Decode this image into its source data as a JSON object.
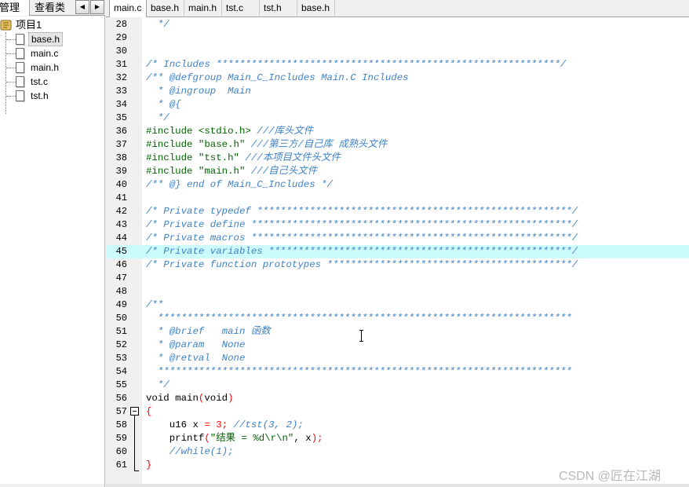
{
  "left_panel": {
    "tabs": [
      "目管理",
      "查看类"
    ],
    "nav": {
      "prev": "◀",
      "next": "▶"
    },
    "tree": {
      "root": "项目1",
      "files": [
        "base.h",
        "main.c",
        "main.h",
        "tst.c",
        "tst.h"
      ],
      "selected": "base.h"
    }
  },
  "editor": {
    "tabs": [
      "main.c",
      "base.h",
      "main.h",
      "tst.c",
      "tst.h",
      "base.h"
    ],
    "active_tab": "main.c",
    "highlighted_line": 45,
    "lines": [
      {
        "n": "28",
        "t": [
          [
            "c",
            "  */"
          ]
        ]
      },
      {
        "n": "29",
        "t": []
      },
      {
        "n": "30",
        "t": []
      },
      {
        "n": "31",
        "t": [
          [
            "c",
            "/* Includes ***********************************************************/"
          ]
        ]
      },
      {
        "n": "32",
        "t": [
          [
            "c",
            "/** @defgroup Main_C_Includes Main.C Includes"
          ]
        ]
      },
      {
        "n": "33",
        "t": [
          [
            "c",
            "  * @ingroup  Main"
          ]
        ]
      },
      {
        "n": "34",
        "t": [
          [
            "c",
            "  * @{"
          ]
        ]
      },
      {
        "n": "35",
        "t": [
          [
            "c",
            "  */"
          ]
        ]
      },
      {
        "n": "36",
        "t": [
          [
            "d",
            "#include "
          ],
          [
            "s",
            "<stdio.h>"
          ],
          [
            "c",
            " ///库头文件"
          ]
        ]
      },
      {
        "n": "37",
        "t": [
          [
            "d",
            "#include "
          ],
          [
            "s",
            "\"base.h\""
          ],
          [
            "c",
            " ///第三方/自己库 成熟头文件"
          ]
        ]
      },
      {
        "n": "38",
        "t": [
          [
            "d",
            "#include "
          ],
          [
            "s",
            "\"tst.h\""
          ],
          [
            "c",
            " ///本项目文件头文件"
          ]
        ]
      },
      {
        "n": "39",
        "t": [
          [
            "d",
            "#include "
          ],
          [
            "s",
            "\"main.h\""
          ],
          [
            "c",
            " ///自己头文件"
          ]
        ]
      },
      {
        "n": "40",
        "t": [
          [
            "c",
            "/** @} end of Main_C_Includes */"
          ]
        ]
      },
      {
        "n": "41",
        "t": []
      },
      {
        "n": "42",
        "t": [
          [
            "c",
            "/* Private typedef ******************************************************/"
          ]
        ]
      },
      {
        "n": "43",
        "t": [
          [
            "c",
            "/* Private define *******************************************************/"
          ]
        ]
      },
      {
        "n": "44",
        "t": [
          [
            "c",
            "/* Private macros *******************************************************/"
          ]
        ]
      },
      {
        "n": "45",
        "t": [
          [
            "c",
            "/* Private variables ****************************************************/"
          ]
        ]
      },
      {
        "n": "46",
        "t": [
          [
            "c",
            "/* Private function prototypes ******************************************/"
          ]
        ]
      },
      {
        "n": "47",
        "t": []
      },
      {
        "n": "48",
        "t": []
      },
      {
        "n": "49",
        "t": [
          [
            "c",
            "/**"
          ]
        ]
      },
      {
        "n": "50",
        "t": [
          [
            "c",
            "  ***********************************************************************"
          ]
        ]
      },
      {
        "n": "51",
        "t": [
          [
            "c",
            "  * @brief   main 函数"
          ]
        ]
      },
      {
        "n": "52",
        "t": [
          [
            "c",
            "  * @param   None"
          ]
        ]
      },
      {
        "n": "53",
        "t": [
          [
            "c",
            "  * @retval  None"
          ]
        ]
      },
      {
        "n": "54",
        "t": [
          [
            "c",
            "  ***********************************************************************"
          ]
        ]
      },
      {
        "n": "55",
        "t": [
          [
            "c",
            "  */"
          ]
        ]
      },
      {
        "n": "56",
        "t": [
          [
            "p",
            "void main"
          ],
          [
            "r",
            "("
          ],
          [
            "p",
            "void"
          ],
          [
            "r",
            ")"
          ]
        ]
      },
      {
        "n": "57",
        "t": [
          [
            "r",
            "{"
          ]
        ]
      },
      {
        "n": "58",
        "t": [
          [
            "p",
            "    u16 x "
          ],
          [
            "r",
            "="
          ],
          [
            "p",
            " "
          ],
          [
            "r",
            "3"
          ],
          [
            "r",
            ";"
          ],
          [
            "c",
            " //tst(3, 2);"
          ]
        ]
      },
      {
        "n": "59",
        "t": [
          [
            "p",
            "    printf"
          ],
          [
            "r",
            "("
          ],
          [
            "s",
            "\"结果 = %d\\r\\n\""
          ],
          [
            "p",
            ", x"
          ],
          [
            "r",
            ");"
          ]
        ]
      },
      {
        "n": "60",
        "t": [
          [
            "c",
            "    //while(1);"
          ]
        ]
      },
      {
        "n": "61",
        "t": [
          [
            "r",
            "}"
          ]
        ]
      }
    ]
  },
  "watermark": "CSDN @匠在江湖",
  "colors": {
    "comment": "#3f82c5",
    "directive": "#006400",
    "string": "#006400",
    "operator": "#ff0000",
    "highlight": "#ccfcfc"
  }
}
